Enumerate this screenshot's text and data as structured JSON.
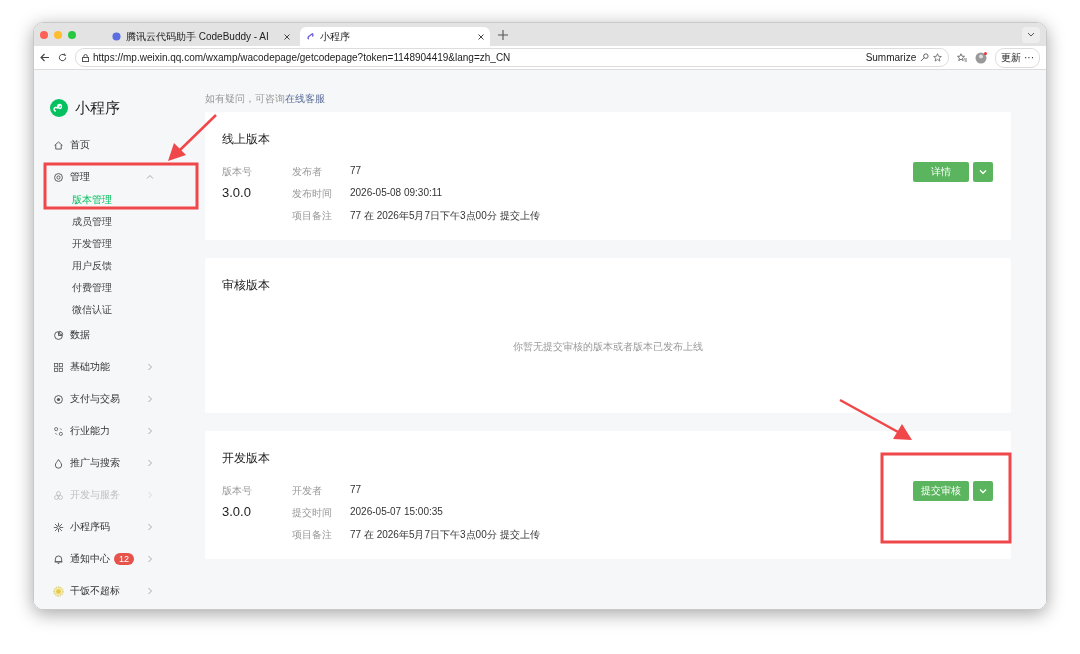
{
  "browser": {
    "tabs": [
      {
        "title": "腾讯云代码助手 CodeBuddy - AI",
        "selected": false
      },
      {
        "title": "小程序",
        "selected": true
      }
    ],
    "url": "https://mp.weixin.qq.com/wxamp/wacodepage/getcodepage?token=1148904419&lang=zh_CN",
    "summarize": "Summarize",
    "update_button": "更新",
    "more": "···"
  },
  "sidebar": {
    "logo": "小程序",
    "items": [
      {
        "label": "首页",
        "disabled": false
      },
      {
        "label": "管理",
        "expanded": true,
        "disabled": false,
        "children": [
          {
            "label": "版本管理",
            "selected": true
          },
          {
            "label": "成员管理",
            "selected": false
          },
          {
            "label": "开发管理",
            "selected": false
          },
          {
            "label": "用户反馈",
            "selected": false
          },
          {
            "label": "付费管理",
            "selected": false
          },
          {
            "label": "微信认证",
            "selected": false
          }
        ]
      },
      {
        "label": "数据",
        "disabled": false
      },
      {
        "label": "基础功能",
        "expanded": false,
        "disabled": false
      },
      {
        "label": "支付与交易",
        "expanded": false,
        "disabled": false
      },
      {
        "label": "行业能力",
        "expanded": false,
        "disabled": false
      },
      {
        "label": "推广与搜索",
        "expanded": false,
        "disabled": false
      },
      {
        "label": "开发与服务",
        "expanded": false,
        "disabled": true
      },
      {
        "label": "小程序码",
        "expanded": false,
        "disabled": false
      },
      {
        "label": "通知中心",
        "expanded": false,
        "disabled": false,
        "badge": "12"
      },
      {
        "label": "干饭不超标",
        "expanded": false,
        "disabled": false
      }
    ]
  },
  "help": {
    "text": "如有疑问，可咨询",
    "link": "在线客服"
  },
  "cards": [
    {
      "kind": "version",
      "title": "线上版本",
      "version_label": "版本号",
      "version": "3.0.0",
      "fields": [
        {
          "label": "发布者",
          "value": "77"
        },
        {
          "label": "发布时间",
          "value": "2026-05-08 09:30:11"
        },
        {
          "label": "项目备注",
          "value": "77 在 2026年5月7日下午3点00分 提交上传"
        }
      ],
      "button": "详情"
    },
    {
      "kind": "empty",
      "title": "审核版本",
      "message": "你暂无提交审核的版本或者版本已发布上线"
    },
    {
      "kind": "version",
      "title": "开发版本",
      "version_label": "版本号",
      "version": "3.0.0",
      "fields": [
        {
          "label": "开发者",
          "value": "77"
        },
        {
          "label": "提交时间",
          "value": "2026-05-07 15:00:35"
        },
        {
          "label": "项目备注",
          "value": "77 在 2026年5月7日下午3点00分 提交上传"
        }
      ],
      "button": "提交审核"
    }
  ]
}
